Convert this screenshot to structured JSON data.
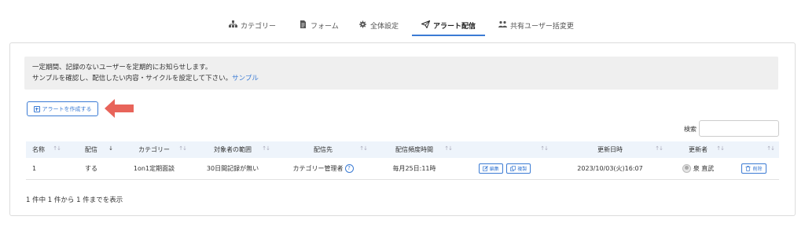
{
  "tabs": [
    {
      "label": "カテゴリー",
      "icon": "category-tree-icon"
    },
    {
      "label": "フォーム",
      "icon": "document-icon"
    },
    {
      "label": "全体設定",
      "icon": "gear-icon"
    },
    {
      "label": "アラート配信",
      "icon": "send-icon"
    },
    {
      "label": "共有ユーザー括変更",
      "icon": "users-icon"
    }
  ],
  "notice": {
    "line1": "一定期間、記録のないユーザーを定期的にお知らせします。",
    "line2": "サンプルを確認し、配信したい内容・サイクルを設定して下さい。",
    "link": "サンプル"
  },
  "create_button": "アラートを作成する",
  "accent_color": "#3b7bd4",
  "arrow_color": "#e8645a",
  "search": {
    "label": "検索",
    "value": ""
  },
  "table": {
    "headers": [
      "名称",
      "配信",
      "カテゴリー",
      "対象者の範囲",
      "配信先",
      "配信頻度時間",
      "",
      "更新日時",
      "更新者",
      ""
    ],
    "rows": [
      {
        "name": "1",
        "delivery": "する",
        "category": "1on1定期面談",
        "scope": "30日間記録が無い",
        "destination": "カテゴリー管理者",
        "frequency": "毎月25日:11時",
        "edit": "編集",
        "copy": "複製",
        "updated_at": "2023/10/03(火)16:07",
        "updated_by": "泉 直武",
        "delete": "削除"
      }
    ]
  },
  "footer": "1 件中 1 件から 1 件までを表示"
}
